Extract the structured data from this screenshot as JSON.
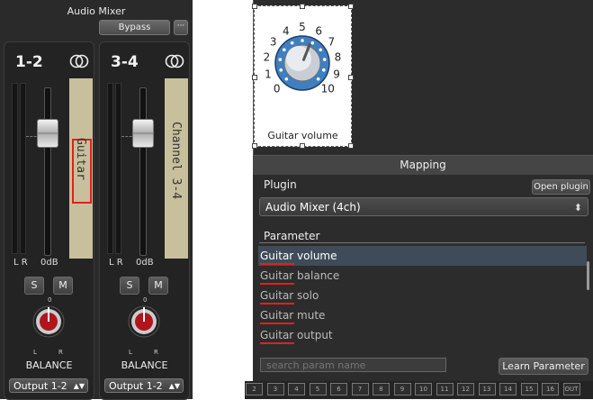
{
  "mixer": {
    "title": "Audio Mixer",
    "bypass_label": "Bypass",
    "more_label": "···",
    "strips": [
      {
        "name": "1-2",
        "tape_label": "Guitar",
        "lr": "L R",
        "level": "0dB",
        "solo": "S",
        "mute": "M",
        "balance_zero": "0",
        "balance_l": "L",
        "balance_r": "R",
        "balance_label": "BALANCE",
        "output": "Output 1-2"
      },
      {
        "name": "3-4",
        "tape_label": "Channel 3-4",
        "lr": "L R",
        "level": "0dB",
        "solo": "S",
        "mute": "M",
        "balance_zero": "0",
        "balance_l": "L",
        "balance_r": "R",
        "balance_label": "BALANCE",
        "output": "Output 1-2"
      }
    ]
  },
  "knob_widget": {
    "scale": [
      "0",
      "1",
      "2",
      "3",
      "4",
      "5",
      "6",
      "7",
      "8",
      "9",
      "10"
    ],
    "caption": "Guitar volume",
    "value_fraction": 0.58
  },
  "mapping": {
    "header": "Mapping",
    "plugin_label": "Plugin",
    "open_plugin": "Open plugin",
    "plugin_value": "Audio Mixer (4ch)",
    "parameter_label": "Parameter",
    "params": [
      {
        "label": "Guitar volume",
        "selected": true
      },
      {
        "label": "Guitar balance",
        "selected": false
      },
      {
        "label": "Guitar solo",
        "selected": false
      },
      {
        "label": "Guitar mute",
        "selected": false
      },
      {
        "label": "Guitar output",
        "selected": false
      }
    ],
    "search_placeholder": "search param name",
    "learn_button": "Learn Parameter"
  },
  "bottom": {
    "channels": [
      "2",
      "3",
      "4",
      "5",
      "6",
      "7",
      "8",
      "9",
      "10",
      "11",
      "12",
      "13",
      "14",
      "15",
      "16",
      "OUT"
    ]
  },
  "colors": {
    "accent_blue": "#3f7fc0",
    "highlight_red": "#e02020",
    "knob_red": "#b0151d",
    "selected_row": "#3f4b59"
  }
}
